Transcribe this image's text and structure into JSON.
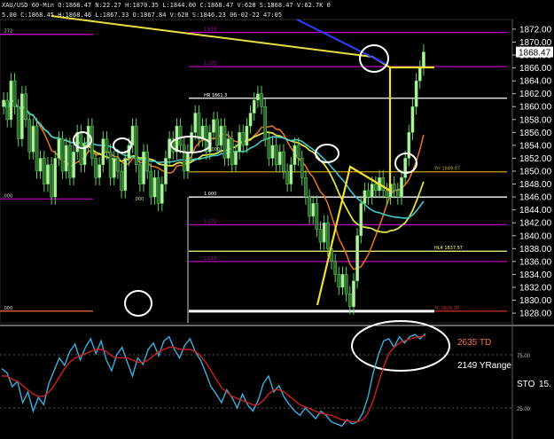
{
  "header": {
    "line1": "XAU/USD 60-Min  O:1868.47  N:22.27  H:1870.35  L:1844.00  C:1868.47  V:628  S:1868.47  V:62.7K  0",
    "line2": "5.00  C:1868.45  H:1868.46  L:1867.33  O:1867.84  V:628  S:1846.23  06-02-22  47:05"
  },
  "chart_data": [
    {
      "type": "candlestick",
      "title": "XAU/USD 60-Min",
      "ylim": [
        1826.5,
        1873.5
      ],
      "y_ticks": [
        1828,
        1830,
        1832,
        1834,
        1836,
        1838,
        1840,
        1842,
        1844,
        1846,
        1848,
        1850,
        1852,
        1854,
        1856,
        1858,
        1860,
        1862,
        1864,
        1866,
        1868,
        1870,
        1872
      ],
      "last_price": 1868.47,
      "close": [
        1861,
        1858,
        1864,
        1860,
        1855,
        1862,
        1858,
        1853,
        1857,
        1850,
        1852,
        1848,
        1851,
        1846,
        1852,
        1855,
        1850,
        1854,
        1849,
        1853,
        1856,
        1851,
        1854,
        1857,
        1852,
        1849,
        1851,
        1855,
        1853,
        1849,
        1852,
        1850,
        1847,
        1852,
        1854,
        1857,
        1851,
        1848,
        1853,
        1850,
        1846,
        1849,
        1845,
        1848,
        1852,
        1855,
        1853,
        1857,
        1854,
        1850,
        1853,
        1856,
        1859,
        1855,
        1857,
        1853,
        1856,
        1858,
        1854,
        1857,
        1852,
        1855,
        1851,
        1853,
        1856,
        1854,
        1857,
        1859,
        1861,
        1862,
        1860,
        1855,
        1852,
        1854,
        1851,
        1853,
        1850,
        1848,
        1851,
        1854,
        1852,
        1849,
        1846,
        1843,
        1845,
        1841,
        1839,
        1842,
        1838,
        1836,
        1834,
        1832,
        1834,
        1831,
        1829,
        1833,
        1840,
        1845,
        1847,
        1846,
        1848,
        1847,
        1849,
        1847,
        1846,
        1848,
        1847,
        1846,
        1849,
        1852,
        1856,
        1860,
        1864,
        1866,
        1868.47
      ],
      "levels": [
        {
          "price": 1871.5,
          "label": "1.618",
          "color": "#c000c0"
        },
        {
          "price": 1866.2,
          "label": "1.272",
          "color": "#c000c0"
        },
        {
          "price": 1861.3,
          "label": "HR 1861.3",
          "color": "#ffffff"
        },
        {
          "price": 1849.9,
          "label": "YH 1849.87",
          "color": "#c8a000"
        },
        {
          "price": 1846.0,
          "label": "1.000",
          "color": "#ffffff"
        },
        {
          "price": 1841.7,
          "label": "1.272",
          "color": "#c000c0"
        },
        {
          "price": 1837.6,
          "label": "HL4 1837.57",
          "color": "#ffff80"
        },
        {
          "price": 1836.0,
          "label": "1.618",
          "color": "#c000c0"
        },
        {
          "price": 1828.3,
          "label": "YL 1828.30",
          "color": "#d03020"
        }
      ],
      "left_labels": [
        {
          "price": 1871.2,
          "label": ".272"
        },
        {
          "price": 1845.7,
          "label": ".000"
        },
        {
          "price": 1828.3,
          "label": ".000"
        }
      ],
      "extra_labels": [
        {
          "price": 1853.6,
          "label": ".000"
        },
        {
          "price": 1846.0,
          "label": ".000"
        }
      ],
      "mid_level_label": "1.000"
    },
    {
      "type": "line",
      "title": "STO",
      "ylim": [
        0,
        100
      ],
      "y_ticks": [
        25.0,
        75.0
      ],
      "y_tick_labels": [
        "25.00",
        "75.00"
      ],
      "series": [
        {
          "name": "",
          "color": "#38b0e0",
          "values": [
            62,
            58,
            45,
            50,
            30,
            40,
            22,
            35,
            28,
            48,
            60,
            72,
            65,
            78,
            85,
            70,
            82,
            90,
            76,
            88,
            70,
            60,
            75,
            82,
            68,
            55,
            72,
            66,
            80,
            86,
            74,
            88,
            92,
            80,
            72,
            84,
            90,
            78,
            70,
            58,
            45,
            38,
            30,
            42,
            35,
            25,
            38,
            28,
            22,
            32,
            48,
            55,
            40,
            46,
            35,
            28,
            22,
            18,
            25,
            20,
            15,
            22,
            18,
            12,
            10,
            8,
            14,
            10,
            12,
            20,
            35,
            58,
            75,
            88,
            90,
            82,
            92,
            86,
            92,
            94,
            90,
            95
          ]
        },
        {
          "name": "",
          "color": "#d02020",
          "values": [
            55,
            55,
            52,
            50,
            46,
            42,
            38,
            36,
            36,
            40,
            46,
            54,
            62,
            68,
            72,
            74,
            76,
            78,
            80,
            80,
            78,
            74,
            72,
            72,
            72,
            70,
            68,
            68,
            70,
            74,
            78,
            80,
            82,
            82,
            80,
            80,
            80,
            78,
            74,
            68,
            60,
            52,
            44,
            40,
            36,
            34,
            32,
            30,
            28,
            28,
            32,
            38,
            42,
            42,
            40,
            36,
            32,
            28,
            26,
            24,
            22,
            20,
            19,
            18,
            16,
            14,
            13,
            12,
            12,
            14,
            20,
            32,
            48,
            64,
            76,
            82,
            86,
            88,
            90,
            91,
            92,
            93
          ]
        }
      ]
    }
  ],
  "annotations": {
    "td_label": "2635 TD",
    "yrange_label": "2149 YRange",
    "sto_label": "STO",
    "sto_value": "15.",
    "price_box": "1868.47"
  }
}
